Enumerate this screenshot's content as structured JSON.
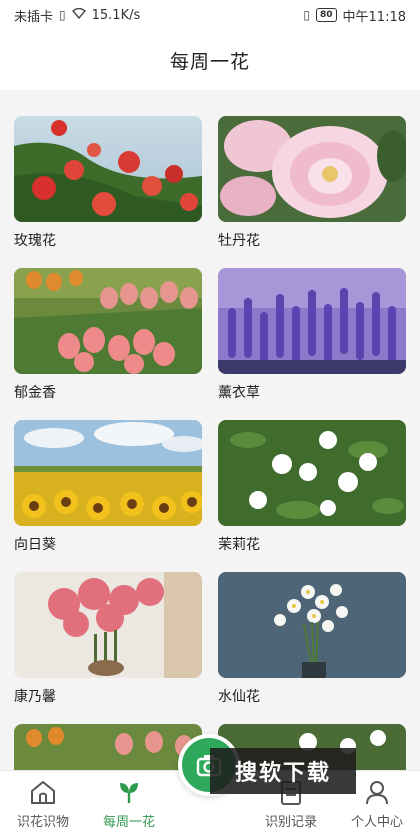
{
  "status_bar": {
    "carrier": "未插卡",
    "speed": "15.1K/s",
    "battery": "80",
    "time": "中午11:18"
  },
  "header": {
    "title": "每周一花"
  },
  "flowers": [
    {
      "name": "玫瑰花"
    },
    {
      "name": "牡丹花"
    },
    {
      "name": "郁金香"
    },
    {
      "name": "薰衣草"
    },
    {
      "name": "向日葵"
    },
    {
      "name": "茉莉花"
    },
    {
      "name": "康乃馨"
    },
    {
      "name": "水仙花"
    }
  ],
  "bottom_nav": {
    "items": [
      {
        "label": "识花识物",
        "icon": "home-icon"
      },
      {
        "label": "每周一花",
        "icon": "flower-sprout-icon"
      },
      {
        "label": "识别记录",
        "icon": "record-icon"
      },
      {
        "label": "个人中心",
        "icon": "user-icon"
      }
    ],
    "active": "每周一花"
  },
  "watermark": "搜软下载",
  "colors": {
    "accent": "#2e9a4d",
    "fab": "#2ea85a"
  }
}
